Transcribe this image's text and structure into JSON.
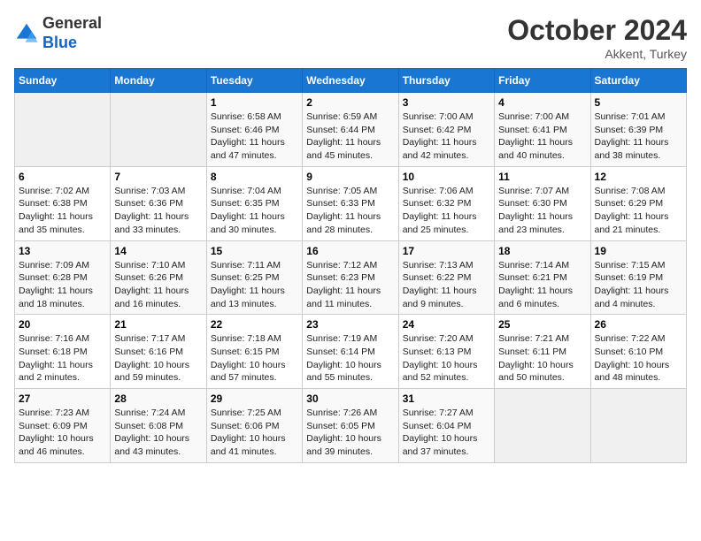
{
  "header": {
    "logo_line1": "General",
    "logo_line2": "Blue",
    "month": "October 2024",
    "location": "Akkent, Turkey"
  },
  "days_of_week": [
    "Sunday",
    "Monday",
    "Tuesday",
    "Wednesday",
    "Thursday",
    "Friday",
    "Saturday"
  ],
  "weeks": [
    [
      {
        "day": "",
        "info": ""
      },
      {
        "day": "",
        "info": ""
      },
      {
        "day": "1",
        "info": "Sunrise: 6:58 AM\nSunset: 6:46 PM\nDaylight: 11 hours and 47 minutes."
      },
      {
        "day": "2",
        "info": "Sunrise: 6:59 AM\nSunset: 6:44 PM\nDaylight: 11 hours and 45 minutes."
      },
      {
        "day": "3",
        "info": "Sunrise: 7:00 AM\nSunset: 6:42 PM\nDaylight: 11 hours and 42 minutes."
      },
      {
        "day": "4",
        "info": "Sunrise: 7:00 AM\nSunset: 6:41 PM\nDaylight: 11 hours and 40 minutes."
      },
      {
        "day": "5",
        "info": "Sunrise: 7:01 AM\nSunset: 6:39 PM\nDaylight: 11 hours and 38 minutes."
      }
    ],
    [
      {
        "day": "6",
        "info": "Sunrise: 7:02 AM\nSunset: 6:38 PM\nDaylight: 11 hours and 35 minutes."
      },
      {
        "day": "7",
        "info": "Sunrise: 7:03 AM\nSunset: 6:36 PM\nDaylight: 11 hours and 33 minutes."
      },
      {
        "day": "8",
        "info": "Sunrise: 7:04 AM\nSunset: 6:35 PM\nDaylight: 11 hours and 30 minutes."
      },
      {
        "day": "9",
        "info": "Sunrise: 7:05 AM\nSunset: 6:33 PM\nDaylight: 11 hours and 28 minutes."
      },
      {
        "day": "10",
        "info": "Sunrise: 7:06 AM\nSunset: 6:32 PM\nDaylight: 11 hours and 25 minutes."
      },
      {
        "day": "11",
        "info": "Sunrise: 7:07 AM\nSunset: 6:30 PM\nDaylight: 11 hours and 23 minutes."
      },
      {
        "day": "12",
        "info": "Sunrise: 7:08 AM\nSunset: 6:29 PM\nDaylight: 11 hours and 21 minutes."
      }
    ],
    [
      {
        "day": "13",
        "info": "Sunrise: 7:09 AM\nSunset: 6:28 PM\nDaylight: 11 hours and 18 minutes."
      },
      {
        "day": "14",
        "info": "Sunrise: 7:10 AM\nSunset: 6:26 PM\nDaylight: 11 hours and 16 minutes."
      },
      {
        "day": "15",
        "info": "Sunrise: 7:11 AM\nSunset: 6:25 PM\nDaylight: 11 hours and 13 minutes."
      },
      {
        "day": "16",
        "info": "Sunrise: 7:12 AM\nSunset: 6:23 PM\nDaylight: 11 hours and 11 minutes."
      },
      {
        "day": "17",
        "info": "Sunrise: 7:13 AM\nSunset: 6:22 PM\nDaylight: 11 hours and 9 minutes."
      },
      {
        "day": "18",
        "info": "Sunrise: 7:14 AM\nSunset: 6:21 PM\nDaylight: 11 hours and 6 minutes."
      },
      {
        "day": "19",
        "info": "Sunrise: 7:15 AM\nSunset: 6:19 PM\nDaylight: 11 hours and 4 minutes."
      }
    ],
    [
      {
        "day": "20",
        "info": "Sunrise: 7:16 AM\nSunset: 6:18 PM\nDaylight: 11 hours and 2 minutes."
      },
      {
        "day": "21",
        "info": "Sunrise: 7:17 AM\nSunset: 6:16 PM\nDaylight: 10 hours and 59 minutes."
      },
      {
        "day": "22",
        "info": "Sunrise: 7:18 AM\nSunset: 6:15 PM\nDaylight: 10 hours and 57 minutes."
      },
      {
        "day": "23",
        "info": "Sunrise: 7:19 AM\nSunset: 6:14 PM\nDaylight: 10 hours and 55 minutes."
      },
      {
        "day": "24",
        "info": "Sunrise: 7:20 AM\nSunset: 6:13 PM\nDaylight: 10 hours and 52 minutes."
      },
      {
        "day": "25",
        "info": "Sunrise: 7:21 AM\nSunset: 6:11 PM\nDaylight: 10 hours and 50 minutes."
      },
      {
        "day": "26",
        "info": "Sunrise: 7:22 AM\nSunset: 6:10 PM\nDaylight: 10 hours and 48 minutes."
      }
    ],
    [
      {
        "day": "27",
        "info": "Sunrise: 7:23 AM\nSunset: 6:09 PM\nDaylight: 10 hours and 46 minutes."
      },
      {
        "day": "28",
        "info": "Sunrise: 7:24 AM\nSunset: 6:08 PM\nDaylight: 10 hours and 43 minutes."
      },
      {
        "day": "29",
        "info": "Sunrise: 7:25 AM\nSunset: 6:06 PM\nDaylight: 10 hours and 41 minutes."
      },
      {
        "day": "30",
        "info": "Sunrise: 7:26 AM\nSunset: 6:05 PM\nDaylight: 10 hours and 39 minutes."
      },
      {
        "day": "31",
        "info": "Sunrise: 7:27 AM\nSunset: 6:04 PM\nDaylight: 10 hours and 37 minutes."
      },
      {
        "day": "",
        "info": ""
      },
      {
        "day": "",
        "info": ""
      }
    ]
  ]
}
